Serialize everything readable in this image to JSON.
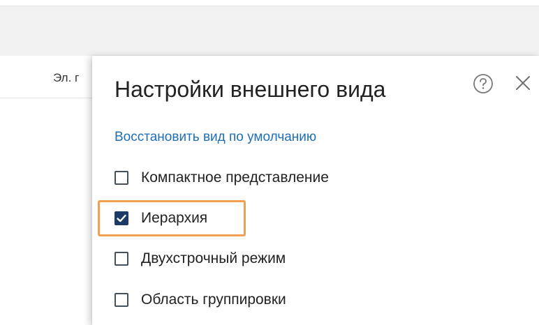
{
  "table": {
    "column_label": "Эл. г"
  },
  "dialog": {
    "title": "Настройки внешнего вида",
    "help_icon": "question-circle-icon",
    "close_icon": "close-icon",
    "restore_link": "Восстановить вид по умолчанию",
    "options": [
      {
        "label": "Компактное представление",
        "checked": false
      },
      {
        "label": "Иерархия",
        "checked": true,
        "highlighted": true
      },
      {
        "label": "Двухстрочный режим",
        "checked": false
      },
      {
        "label": "Область группировки",
        "checked": false
      }
    ]
  },
  "colors": {
    "link": "#1f6fb5",
    "checkbox_checked": "#1d3a66",
    "highlight": "#f0a055",
    "top_band": "#f2f2f2"
  }
}
